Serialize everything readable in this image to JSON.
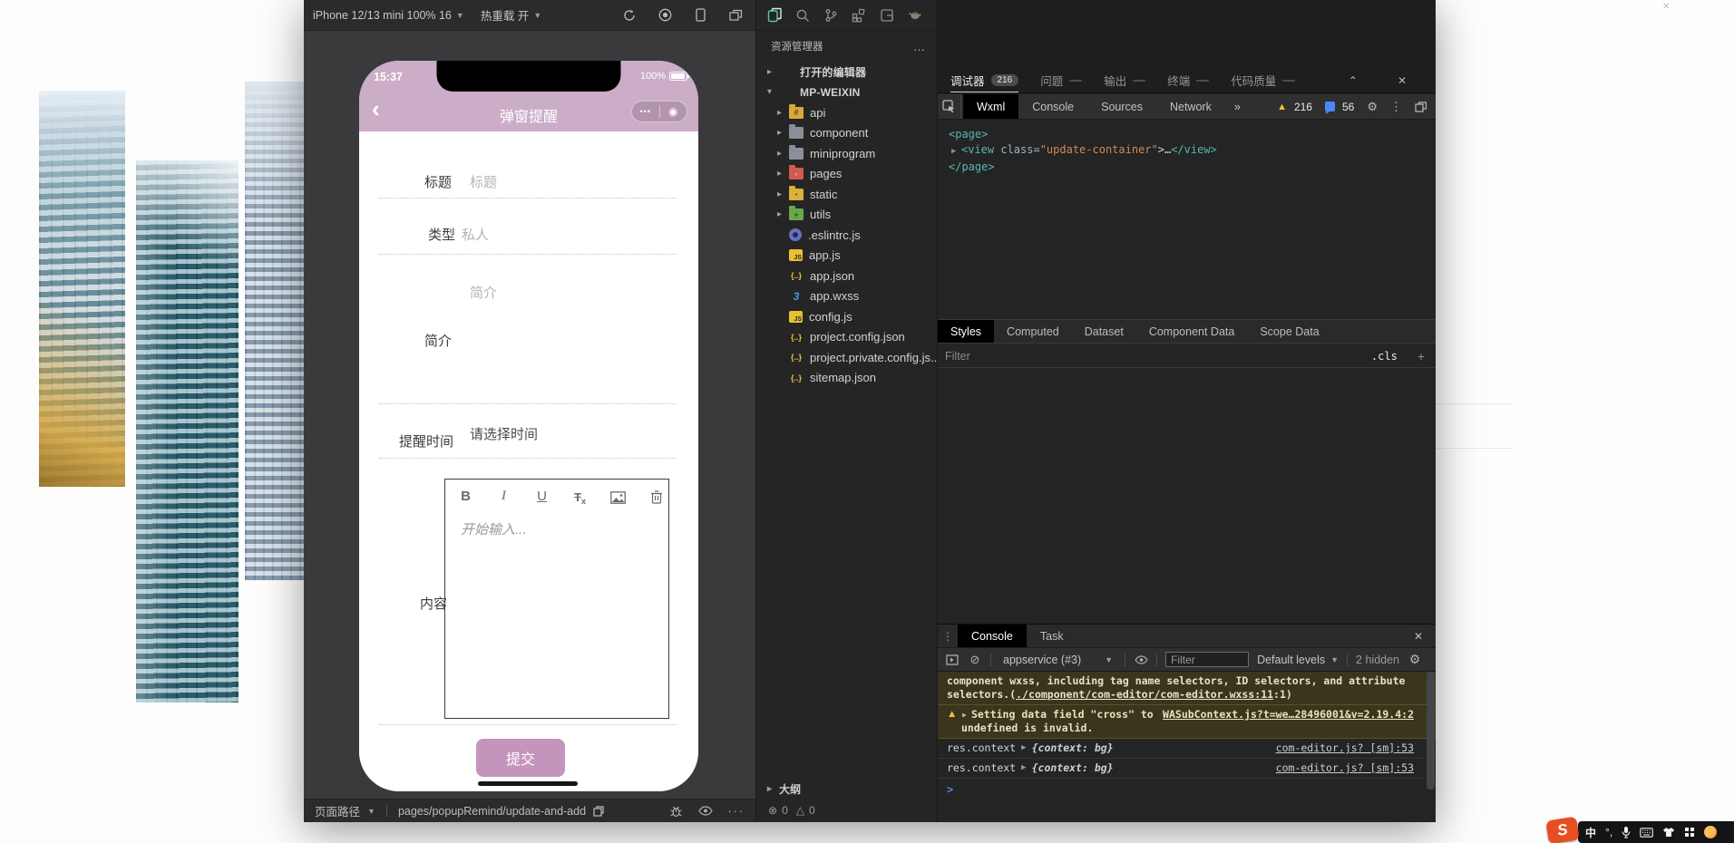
{
  "simulator": {
    "toolbar": {
      "device": "iPhone 12/13 mini 100% 16",
      "hot_reload": "热重载 开"
    },
    "bottombar": {
      "path_label": "页面路径",
      "path": "pages/popupRemind/update-and-add"
    }
  },
  "phone": {
    "status": {
      "time": "15:37",
      "battery": "100%"
    },
    "nav": {
      "back": "‹",
      "title": "弹窗提醒",
      "capsule_dots": "•••",
      "capsule_circle": "◉"
    },
    "form": {
      "title_label": "标题",
      "title_placeholder": "标题",
      "type_label": "类型",
      "type_value": "私人",
      "intro_placeholder": "简介",
      "intro_label": "简介",
      "time_label": "提醒时间",
      "time_placeholder": "请选择时间",
      "content_label": "内容",
      "editor_placeholder": "开始输入...",
      "editor_bold": "B",
      "editor_italic": "I",
      "editor_underline": "U",
      "editor_clearformat": "T",
      "editor_clearformat_sub": "x",
      "submit_label": "提交"
    }
  },
  "explorer": {
    "title": "资源管理器",
    "more": "…",
    "items": [
      {
        "kind": "section",
        "arrow": "▸",
        "icon": "",
        "name": "打开的编辑器"
      },
      {
        "kind": "section",
        "arrow": "▾",
        "icon": "",
        "name": "MP-WEIXIN"
      },
      {
        "kind": "folder",
        "arrow": "▸",
        "icon": "folder-api",
        "name": "api"
      },
      {
        "kind": "folder",
        "arrow": "▸",
        "icon": "folder-gray",
        "name": "component"
      },
      {
        "kind": "folder",
        "arrow": "▸",
        "icon": "folder-gray",
        "name": "miniprogram"
      },
      {
        "kind": "folder",
        "arrow": "▸",
        "icon": "folder-pages",
        "name": "pages"
      },
      {
        "kind": "folder",
        "arrow": "▸",
        "icon": "folder-static",
        "name": "static"
      },
      {
        "kind": "folder",
        "arrow": "▸",
        "icon": "folder-utils",
        "name": "utils"
      },
      {
        "kind": "file",
        "arrow": "",
        "icon": "eslint",
        "name": ".eslintrc.js"
      },
      {
        "kind": "file",
        "arrow": "",
        "icon": "js",
        "name": "app.js"
      },
      {
        "kind": "file",
        "arrow": "",
        "icon": "json",
        "name": "app.json"
      },
      {
        "kind": "file",
        "arrow": "",
        "icon": "wxss",
        "name": "app.wxss"
      },
      {
        "kind": "file",
        "arrow": "",
        "icon": "js",
        "name": "config.js"
      },
      {
        "kind": "file",
        "arrow": "",
        "icon": "json",
        "name": "project.config.json"
      },
      {
        "kind": "file",
        "arrow": "",
        "icon": "json",
        "name": "project.private.config.js..."
      },
      {
        "kind": "file",
        "arrow": "",
        "icon": "json",
        "name": "sitemap.json"
      }
    ],
    "outline": "大纲",
    "status": {
      "error_icon": "⊗",
      "errors": "0",
      "warn_icon": "△",
      "warnings": "0"
    }
  },
  "debugger": {
    "panel_tabs": [
      {
        "label": "调试器",
        "active": "true",
        "badge": "216"
      },
      {
        "label": "问题",
        "active": "false",
        "badge": ""
      },
      {
        "label": "输出",
        "active": "false",
        "badge": ""
      },
      {
        "label": "终端",
        "active": "false",
        "badge": ""
      },
      {
        "label": "代码质量",
        "active": "false",
        "badge": ""
      }
    ],
    "collapse_icon": "⌃",
    "close_icon": "✕",
    "devtools_tabs": [
      {
        "label": "Wxml",
        "active": "true"
      },
      {
        "label": "Console",
        "active": "false"
      },
      {
        "label": "Sources",
        "active": "false"
      },
      {
        "label": "Network",
        "active": "false"
      }
    ],
    "more_tabs": "»",
    "warning_count": "216",
    "info_count": "56",
    "code": {
      "line1": "<page>",
      "line2_arrow": "▶",
      "line2_tag": "<view",
      "line2_attr": " class=",
      "line2_value": "\"update-container\"",
      "line2_rest": ">…",
      "line2_close": "</view>",
      "line3": "</page>"
    },
    "style_tabs": [
      {
        "label": "Styles",
        "active": "true"
      },
      {
        "label": "Computed",
        "active": "false"
      },
      {
        "label": "Dataset",
        "active": "false"
      },
      {
        "label": "Component Data",
        "active": "false"
      },
      {
        "label": "Scope Data",
        "active": "false"
      }
    ],
    "filter_placeholder": "Filter",
    "cls_button": ".cls",
    "plus_button": "+",
    "console": {
      "tabs": [
        {
          "label": "Console",
          "active": "true"
        },
        {
          "label": "Task",
          "active": "false"
        }
      ],
      "close_icon": "✕",
      "block_icon": "⊘",
      "context": "appservice (#3)",
      "filter_placeholder": "Filter",
      "levels": "Default levels",
      "hidden": "2 hidden",
      "msg_warn1_line1": "component wxss, including tag name selectors, ID selectors, and attribute",
      "msg_warn1_line2_pre": "selectors.(",
      "msg_warn1_link": "./component/com-editor/com-editor.wxss:11",
      "msg_warn1_line2_post": ":1)",
      "msg_warn2_text": "Setting data field \"cross\" to",
      "msg_warn2_link": "WASubContext.js?t=we…28496001&v=2.19.4:2",
      "msg_warn2_text2": "undefined is invalid.",
      "msg_log_label": "res.context",
      "msg_log_value": "{context: bg}",
      "msg_log_source": "com-editor.js? [sm]:53",
      "prompt": ">"
    }
  },
  "tray": {
    "sogou": "S",
    "lang": "中",
    "punct": "°,"
  },
  "misc": {
    "window_close": "✕"
  }
}
